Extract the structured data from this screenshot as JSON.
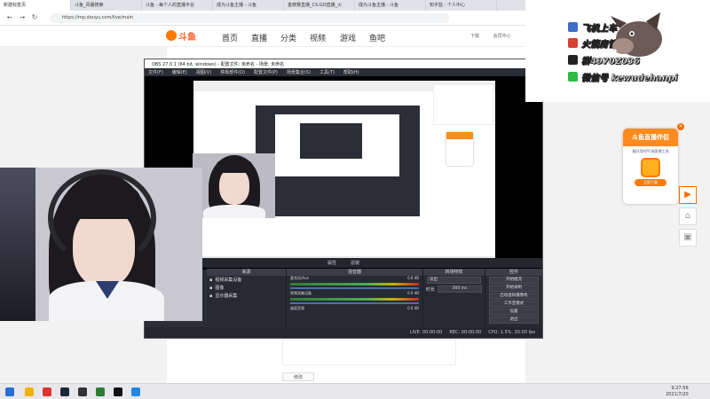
{
  "browser": {
    "tabs": [
      {
        "label": "新建标签页"
      },
      {
        "label": "斗鱼_风播搜索"
      },
      {
        "label": "斗鱼 - 每个人的直播平台"
      },
      {
        "label": "成为斗鱼主播 - 斗鱼"
      },
      {
        "label": "金牌赛直播_CS:GO直播_火"
      },
      {
        "label": "成为斗鱼主播 - 斗鱼"
      },
      {
        "label": "知乎盐 - 个人中心"
      }
    ],
    "url": "https://mp.douyu.com/live/main"
  },
  "site": {
    "logo_text": "斗鱼",
    "nav": [
      "首页",
      "直播",
      "分类",
      "视频",
      "游戏",
      "鱼吧"
    ],
    "header_right": [
      "下载",
      "会员中心"
    ],
    "modify_label": "修改"
  },
  "overlay": {
    "lines": [
      {
        "text": "飞机上车",
        "icon": "plane-icon",
        "color": "#3b6ec9"
      },
      {
        "text": "火箭房管",
        "icon": "rocket-icon",
        "color": "#d8402f"
      },
      {
        "text": "群4970Z036",
        "icon": "qq-icon",
        "color": "#222222"
      },
      {
        "text": "微信号 kewudehanpi",
        "icon": "wechat-icon",
        "color": "#2dbb45"
      }
    ]
  },
  "side_promo": {
    "title": "斗鱼直播伴侣",
    "desc": "最好用的PC端直播工具",
    "download": "立即下载"
  },
  "obs": {
    "title": "OBS 27.0.1 (64 bit, windows) - 配置文件: 未命名 - 场景: 未命名",
    "menu": [
      "文件(F)",
      "编辑(E)",
      "视图(V)",
      "停靠部件(D)",
      "配置文件(P)",
      "场景集合(S)",
      "工具(T)",
      "帮助(H)"
    ],
    "scene_bar": [
      "属性",
      "滤镜"
    ],
    "docks": {
      "scenes_title": "来源",
      "sources": [
        "视频采集设备",
        "图像",
        "显示器采集"
      ],
      "mixer_title": "混音器",
      "mixer_channels": [
        {
          "label": "麦克风/Aux",
          "level": "0.0 dB"
        },
        {
          "label": "视频采集设备",
          "level": "0.0 dB"
        },
        {
          "label": "桌面音频",
          "level": "0.0 dB"
        }
      ],
      "transition_title": "转场特效",
      "transition_value": "淡出",
      "duration_label": "时长",
      "duration_value": "300 ms",
      "controls_title": "控件",
      "controls": [
        "开始推流",
        "开始录制",
        "启动虚拟摄像机",
        "工作室模式",
        "设置",
        "退出"
      ]
    },
    "status": [
      "LIVE: 00:00:00",
      "REC: 00:00:00",
      "CPU: 1.5%, 30.00 fps"
    ]
  },
  "taskbar": {
    "time": "9:27:56",
    "date": "2021/7/20"
  },
  "colors": {
    "brand": "#ff7a00",
    "obs_bg": "#2b2e38"
  }
}
